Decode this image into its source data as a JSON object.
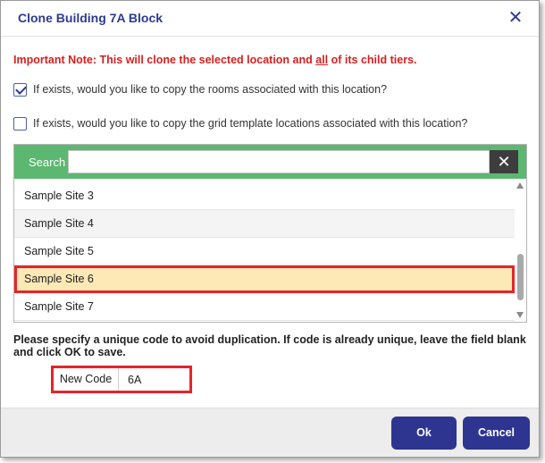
{
  "dialog": {
    "title": "Clone Building 7A Block",
    "close_icon": "close-icon"
  },
  "note": {
    "prefix": "Important Note: This will clone the selected location and ",
    "emphasis": "all",
    "suffix": " of its child tiers."
  },
  "options": [
    {
      "label": "If exists, would you like to copy the rooms associated with this location?",
      "checked": true
    },
    {
      "label": "If exists, would you like to copy the grid template locations associated with this location?",
      "checked": false
    }
  ],
  "search": {
    "label": "Search",
    "value": "",
    "clear_icon": "clear-icon"
  },
  "locations": [
    {
      "label": "Sample Site 3",
      "selected": false
    },
    {
      "label": "Sample Site 4",
      "selected": false
    },
    {
      "label": "Sample Site 5",
      "selected": false
    },
    {
      "label": "Sample Site 6",
      "selected": true
    },
    {
      "label": "Sample Site 7",
      "selected": false
    }
  ],
  "instructions": "Please specify a unique code to avoid duplication. If code is already unique, leave the field blank and click OK to save.",
  "new_code": {
    "label": "New Code",
    "value": "6A"
  },
  "footer": {
    "ok_label": "Ok",
    "cancel_label": "Cancel"
  },
  "colors": {
    "accent": "#2d3591",
    "search_bar": "#5cb870",
    "warning": "#d62020",
    "selected_row": "#fce9b6",
    "highlight_border": "#e5242b"
  }
}
